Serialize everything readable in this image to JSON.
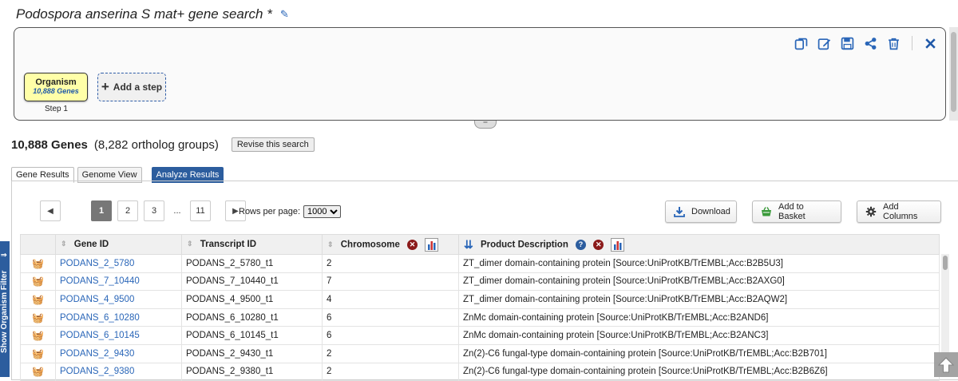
{
  "search": {
    "title": "Podospora anserina S mat+ gene search *"
  },
  "strategy": {
    "step_name": "Organism",
    "step_count": "10,888 Genes",
    "step_label": "Step 1",
    "add_step_label": "Add a step"
  },
  "results": {
    "count": "10,888 Genes",
    "orthologs": "(8,282 ortholog groups)",
    "revise_label": "Revise this search"
  },
  "tabs": [
    {
      "label": "Gene Results"
    },
    {
      "label": "Genome View"
    },
    {
      "label": "Analyze Results"
    }
  ],
  "pager": {
    "pages": [
      "1",
      "2",
      "3",
      "...",
      "11"
    ],
    "rows_per_page_label": "Rows per page:",
    "rows_per_page_value": "1000"
  },
  "actions": {
    "download": "Download",
    "add_to_basket": "Add to Basket",
    "add_columns": "Add Columns"
  },
  "table": {
    "headers": [
      "Gene ID",
      "Transcript ID",
      "Chromosome",
      "Product Description"
    ],
    "rows": [
      [
        "PODANS_2_5780",
        "PODANS_2_5780_t1",
        "2",
        "ZT_dimer domain-containing protein [Source:UniProtKB/TrEMBL;Acc:B2B5U3]"
      ],
      [
        "PODANS_7_10440",
        "PODANS_7_10440_t1",
        "7",
        "ZT_dimer domain-containing protein [Source:UniProtKB/TrEMBL;Acc:B2AXG0]"
      ],
      [
        "PODANS_4_9500",
        "PODANS_4_9500_t1",
        "4",
        "ZT_dimer domain-containing protein [Source:UniProtKB/TrEMBL;Acc:B2AQW2]"
      ],
      [
        "PODANS_6_10280",
        "PODANS_6_10280_t1",
        "6",
        "ZnMc domain-containing protein [Source:UniProtKB/TrEMBL;Acc:B2AND6]"
      ],
      [
        "PODANS_6_10145",
        "PODANS_6_10145_t1",
        "6",
        "ZnMc domain-containing protein [Source:UniProtKB/TrEMBL;Acc:B2ANC3]"
      ],
      [
        "PODANS_2_9430",
        "PODANS_2_9430_t1",
        "2",
        "Zn(2)-C6 fungal-type domain-containing protein [Source:UniProtKB/TrEMBL;Acc:B2B701]"
      ],
      [
        "PODANS_2_9380",
        "PODANS_2_9380_t1",
        "2",
        "Zn(2)-C6 fungal-type domain-containing protein [Source:UniProtKB/TrEMBL;Acc:B2B6Z6]"
      ]
    ]
  },
  "sidebar": {
    "organism_filter": "Show Organism Filter"
  },
  "colors": {
    "accent": "#2c5d9e",
    "link": "#2a66b8",
    "step_box": "#ffffa8",
    "remove": "#8b1a1a"
  },
  "icons": [
    "pencil-icon",
    "copy-icon",
    "edit-icon",
    "save-icon",
    "share-icon",
    "trash-icon",
    "close-icon",
    "download-icon",
    "basket-icon",
    "gear-icon",
    "sort-icon",
    "help-icon",
    "remove-column-icon",
    "histogram-icon",
    "arrow-up-icon"
  ]
}
